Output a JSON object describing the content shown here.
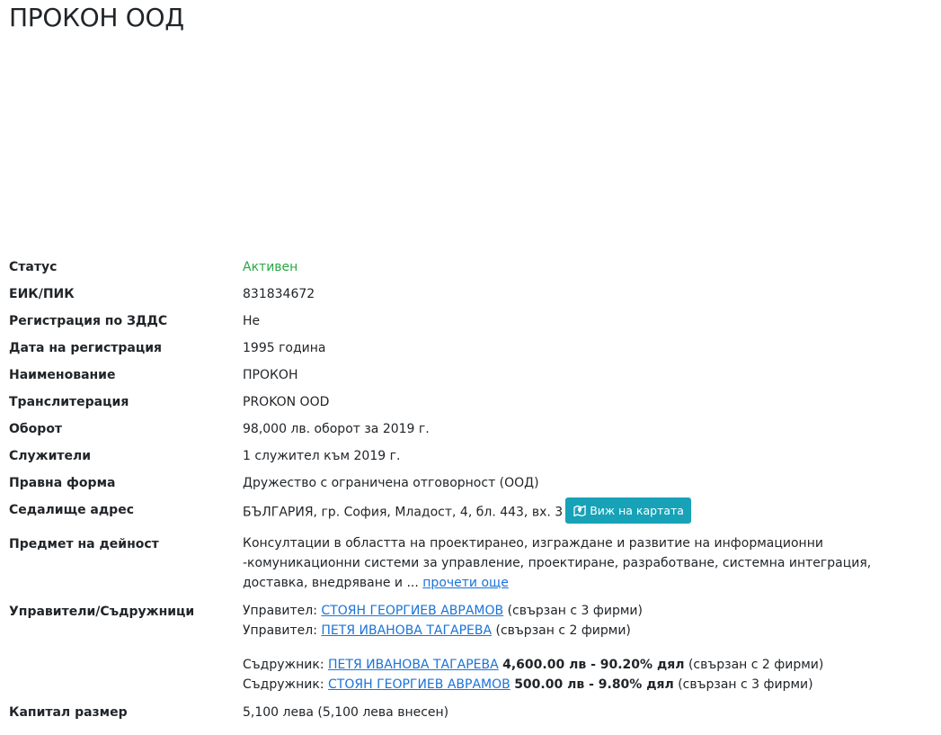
{
  "title": "ПРОКОН ООД",
  "fields": {
    "status": {
      "label": "Статус",
      "value": "Активен"
    },
    "eik": {
      "label": "ЕИК/ПИК",
      "value": "831834672"
    },
    "vat": {
      "label": "Регистрация по ЗДДС",
      "value": "Не"
    },
    "reg_date": {
      "label": "Дата на регистрация",
      "value": "1995 година"
    },
    "name": {
      "label": "Наименование",
      "value": "ПРОКОН"
    },
    "translit": {
      "label": "Транслитерация",
      "value": "PROKON OOD"
    },
    "turnover": {
      "label": "Оборот",
      "value": "98,000 лв. оборот за 2019 г."
    },
    "employees": {
      "label": "Служители",
      "value": "1 служител към 2019 г."
    },
    "legal_form": {
      "label": "Правна форма",
      "value": "Дружество с ограничена отговорност (ООД)"
    },
    "address": {
      "label": "Седалище адрес",
      "value": "БЪЛГАРИЯ, гр. София, Младост, 4, бл. 443, вх. 3",
      "map_button": "Виж на картата"
    },
    "activity": {
      "label": "Предмет на дейност",
      "value": "Консултации в областта на проектиранео, изграждане и развитие на информационни -комуникационни системи за управление, проектиране, разработване, системна интеграция, доставка, внедряване и ...",
      "read_more": "прочети още"
    },
    "managers": {
      "label": "Управители/Съдружници",
      "managers": [
        {
          "role": "Управител:",
          "name": "СТОЯН ГЕОРГИЕВ АВРАМОВ",
          "note": "(свързан с 3 фирми)"
        },
        {
          "role": "Управител:",
          "name": "ПЕТЯ ИВАНОВА ТАГАРЕВА",
          "note": "(свързан с 2 фирми)"
        }
      ],
      "partners": [
        {
          "role": "Съдружник:",
          "name": "ПЕТЯ ИВАНОВА ТАГАРЕВА",
          "share": "4,600.00 лв - 90.20% дял",
          "note": "(свързан с 2 фирми)"
        },
        {
          "role": "Съдружник:",
          "name": "СТОЯН ГЕОРГИЕВ АВРАМОВ",
          "share": "500.00 лв - 9.80% дял",
          "note": "(свързан с 3 фирми)"
        }
      ]
    },
    "capital": {
      "label": "Капитал размер",
      "value": "5,100 лева (5,100 лева внесен)"
    }
  },
  "colors": {
    "status_active": "#28a745",
    "link": "#1a73d9",
    "map_button": "#17a2b8"
  },
  "icons": {
    "map_button_icon": "map-marker-icon"
  }
}
